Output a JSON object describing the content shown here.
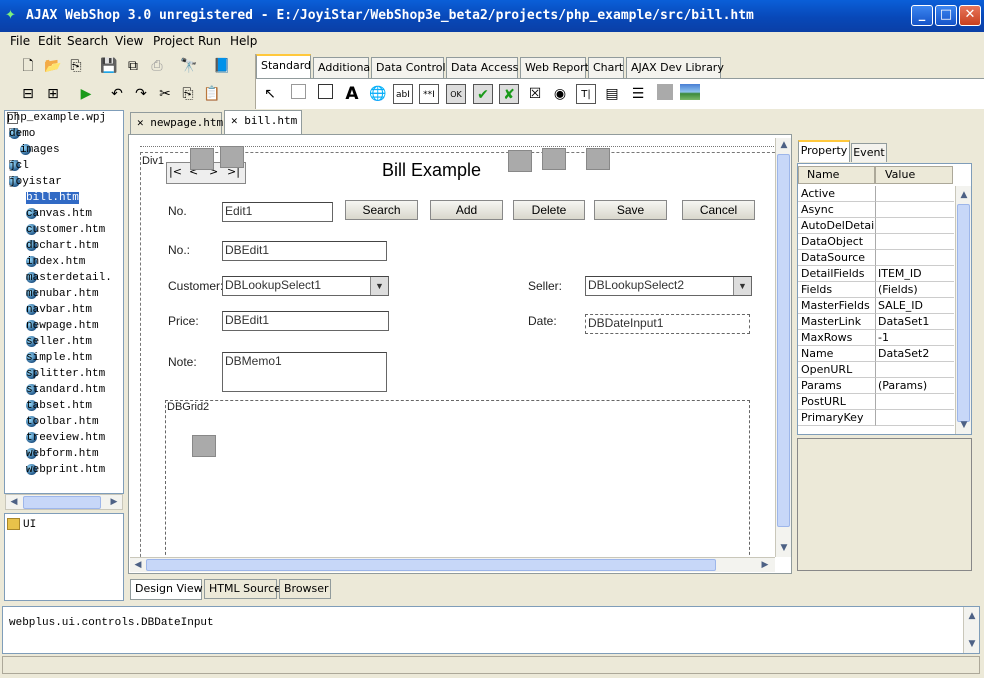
{
  "window": {
    "title": "AJAX WebShop 3.0 unregistered - E:/JoyiStar/WebShop3e_beta2/projects/php_example/src/bill.htm"
  },
  "menu": [
    "File",
    "Edit",
    "Search",
    "View",
    "Project",
    "Run",
    "Help"
  ],
  "palette_tabs": [
    "Standard",
    "Additional",
    "Data Controls",
    "Data Access",
    "Web Report",
    "Chart",
    "AJAX Dev Library"
  ],
  "project": {
    "root": "php_example.wpj",
    "folders": [
      "demo",
      "images",
      "jcl",
      "joyistar"
    ],
    "files": [
      "bill.htm",
      "canvas.htm",
      "customer.htm",
      "dbchart.htm",
      "index.htm",
      "masterdetail.",
      "menubar.htm",
      "navbar.htm",
      "newpage.htm",
      "seller.htm",
      "simple.htm",
      "splitter.htm",
      "standard.htm",
      "tabset.htm",
      "toolbar.htm",
      "treeview.htm",
      "webform.htm",
      "webprint.htm"
    ],
    "selected": "bill.htm",
    "lower_folder": "UI"
  },
  "doc_tabs": [
    {
      "label": "newpage.htm"
    },
    {
      "label": "bill.htm"
    }
  ],
  "form": {
    "div_label": "Div1",
    "title": "Bill Example",
    "no_label": "No.",
    "no_edit": "Edit1",
    "buttons": [
      "Search",
      "Add",
      "Delete",
      "Save",
      "Cancel"
    ],
    "no2_label": "No.:",
    "no2_edit": "DBEdit1",
    "customer_label": "Customer:",
    "customer_value": "DBLookupSelect1",
    "seller_label": "Seller:",
    "seller_value": "DBLookupSelect2",
    "price_label": "Price:",
    "price_edit": "DBEdit1",
    "date_label": "Date:",
    "date_value": "DBDateInput1",
    "note_label": "Note:",
    "note_memo": "DBMemo1",
    "grid_label": "DBGrid2"
  },
  "bottom_tabs": [
    "Design View",
    "HTML Source",
    "Browser"
  ],
  "inspector": {
    "tabs": [
      "Property",
      "Event"
    ],
    "headers": [
      "Name",
      "Value"
    ],
    "rows": [
      [
        "Active",
        ""
      ],
      [
        "Async",
        ""
      ],
      [
        "AutoDelDetails",
        ""
      ],
      [
        "DataObject",
        ""
      ],
      [
        "DataSource",
        ""
      ],
      [
        "DetailFields",
        "ITEM_ID"
      ],
      [
        "Fields",
        "(Fields)"
      ],
      [
        "MasterFields",
        "SALE_ID"
      ],
      [
        "MasterLink",
        "DataSet1"
      ],
      [
        "MaxRows",
        "-1"
      ],
      [
        "Name",
        "DataSet2"
      ],
      [
        "OpenURL",
        ""
      ],
      [
        "Params",
        "(Params)"
      ],
      [
        "PostURL",
        ""
      ],
      [
        "PrimaryKey",
        ""
      ]
    ]
  },
  "status": {
    "message": "webplus.ui.controls.DBDateInput"
  },
  "colors": {
    "titlebar": "#0a5fd8",
    "selection": "#316ac5",
    "tab_highlight": "#ffc83c"
  }
}
